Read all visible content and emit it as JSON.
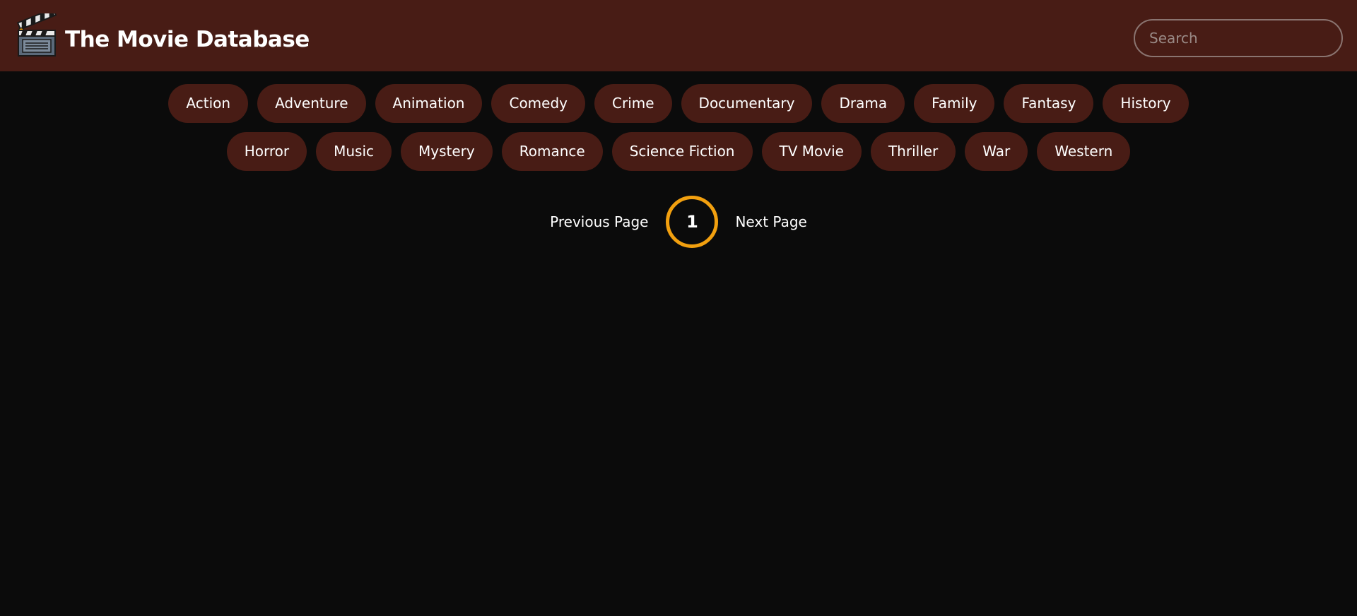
{
  "header": {
    "logo_icon": "clapperboard-icon",
    "title": "The Movie Database",
    "search": {
      "placeholder": "Search",
      "value": ""
    }
  },
  "genres": {
    "row1": [
      "Action",
      "Adventure",
      "Animation",
      "Comedy",
      "Crime",
      "Documentary",
      "Drama",
      "Family",
      "Fantasy",
      "History"
    ],
    "row2": [
      "Horror",
      "Music",
      "Mystery",
      "Romance",
      "Science Fiction",
      "TV Movie",
      "Thriller",
      "War",
      "Western"
    ]
  },
  "pagination": {
    "previous_label": "Previous Page",
    "current_page": "1",
    "next_label": "Next Page"
  },
  "colors": {
    "header_bg": "#481c15",
    "page_bg": "#0b0b0b",
    "pill_bg": "#481c15",
    "accent": "#f2a00f"
  }
}
